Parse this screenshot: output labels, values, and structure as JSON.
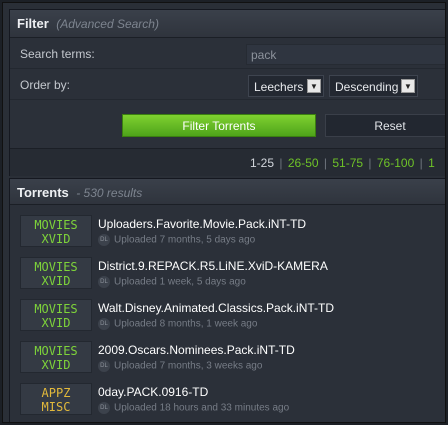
{
  "filter": {
    "title": "Filter",
    "subtitle": "(Advanced Search)",
    "search_label": "Search terms:",
    "search_value": "pack",
    "order_label": "Order by:",
    "order_field": "Leechers",
    "order_direction": "Descending",
    "filter_button": "Filter Torrents",
    "reset_button": "Reset"
  },
  "pagination": {
    "current": "1-25",
    "links": [
      "26-50",
      "51-75",
      "76-100",
      "1"
    ],
    "separator": "|"
  },
  "torrents": {
    "title": "Torrents",
    "count": "- 530 results",
    "items": [
      {
        "cat1": "MOVIES",
        "cat2": "XVID",
        "name": "Uploaders.Favorite.Movie.Pack.iNT-TD",
        "meta": "Uploaded 7 months, 5 days ago",
        "dl": "DL"
      },
      {
        "cat1": "MOVIES",
        "cat2": "XVID",
        "name": "District.9.REPACK.R5.LiNE.XviD-KAMERA",
        "meta": "Uploaded 1 week, 5 days ago",
        "dl": "DL"
      },
      {
        "cat1": "MOVIES",
        "cat2": "XVID",
        "name": "Walt.Disney.Animated.Classics.Pack.iNT-TD",
        "meta": "Uploaded 8 months, 1 week ago",
        "dl": "DL"
      },
      {
        "cat1": "MOVIES",
        "cat2": "XVID",
        "name": "2009.Oscars.Nominees.Pack.iNT-TD",
        "meta": "Uploaded 7 months, 3 weeks ago",
        "dl": "DL"
      },
      {
        "cat1": "APPZ",
        "cat2": "MISC",
        "name": "0day.PACK.0916-TD",
        "meta": "Uploaded 18 hours and 33 minutes ago",
        "dl": "DL"
      }
    ]
  },
  "colors": {
    "accent_green": "#6ec228",
    "movies_category": "#7ed43a",
    "appz_category": "#e2b93b"
  },
  "icons": {
    "select_arrow": "chevron-down-icon",
    "download": "download-icon"
  }
}
